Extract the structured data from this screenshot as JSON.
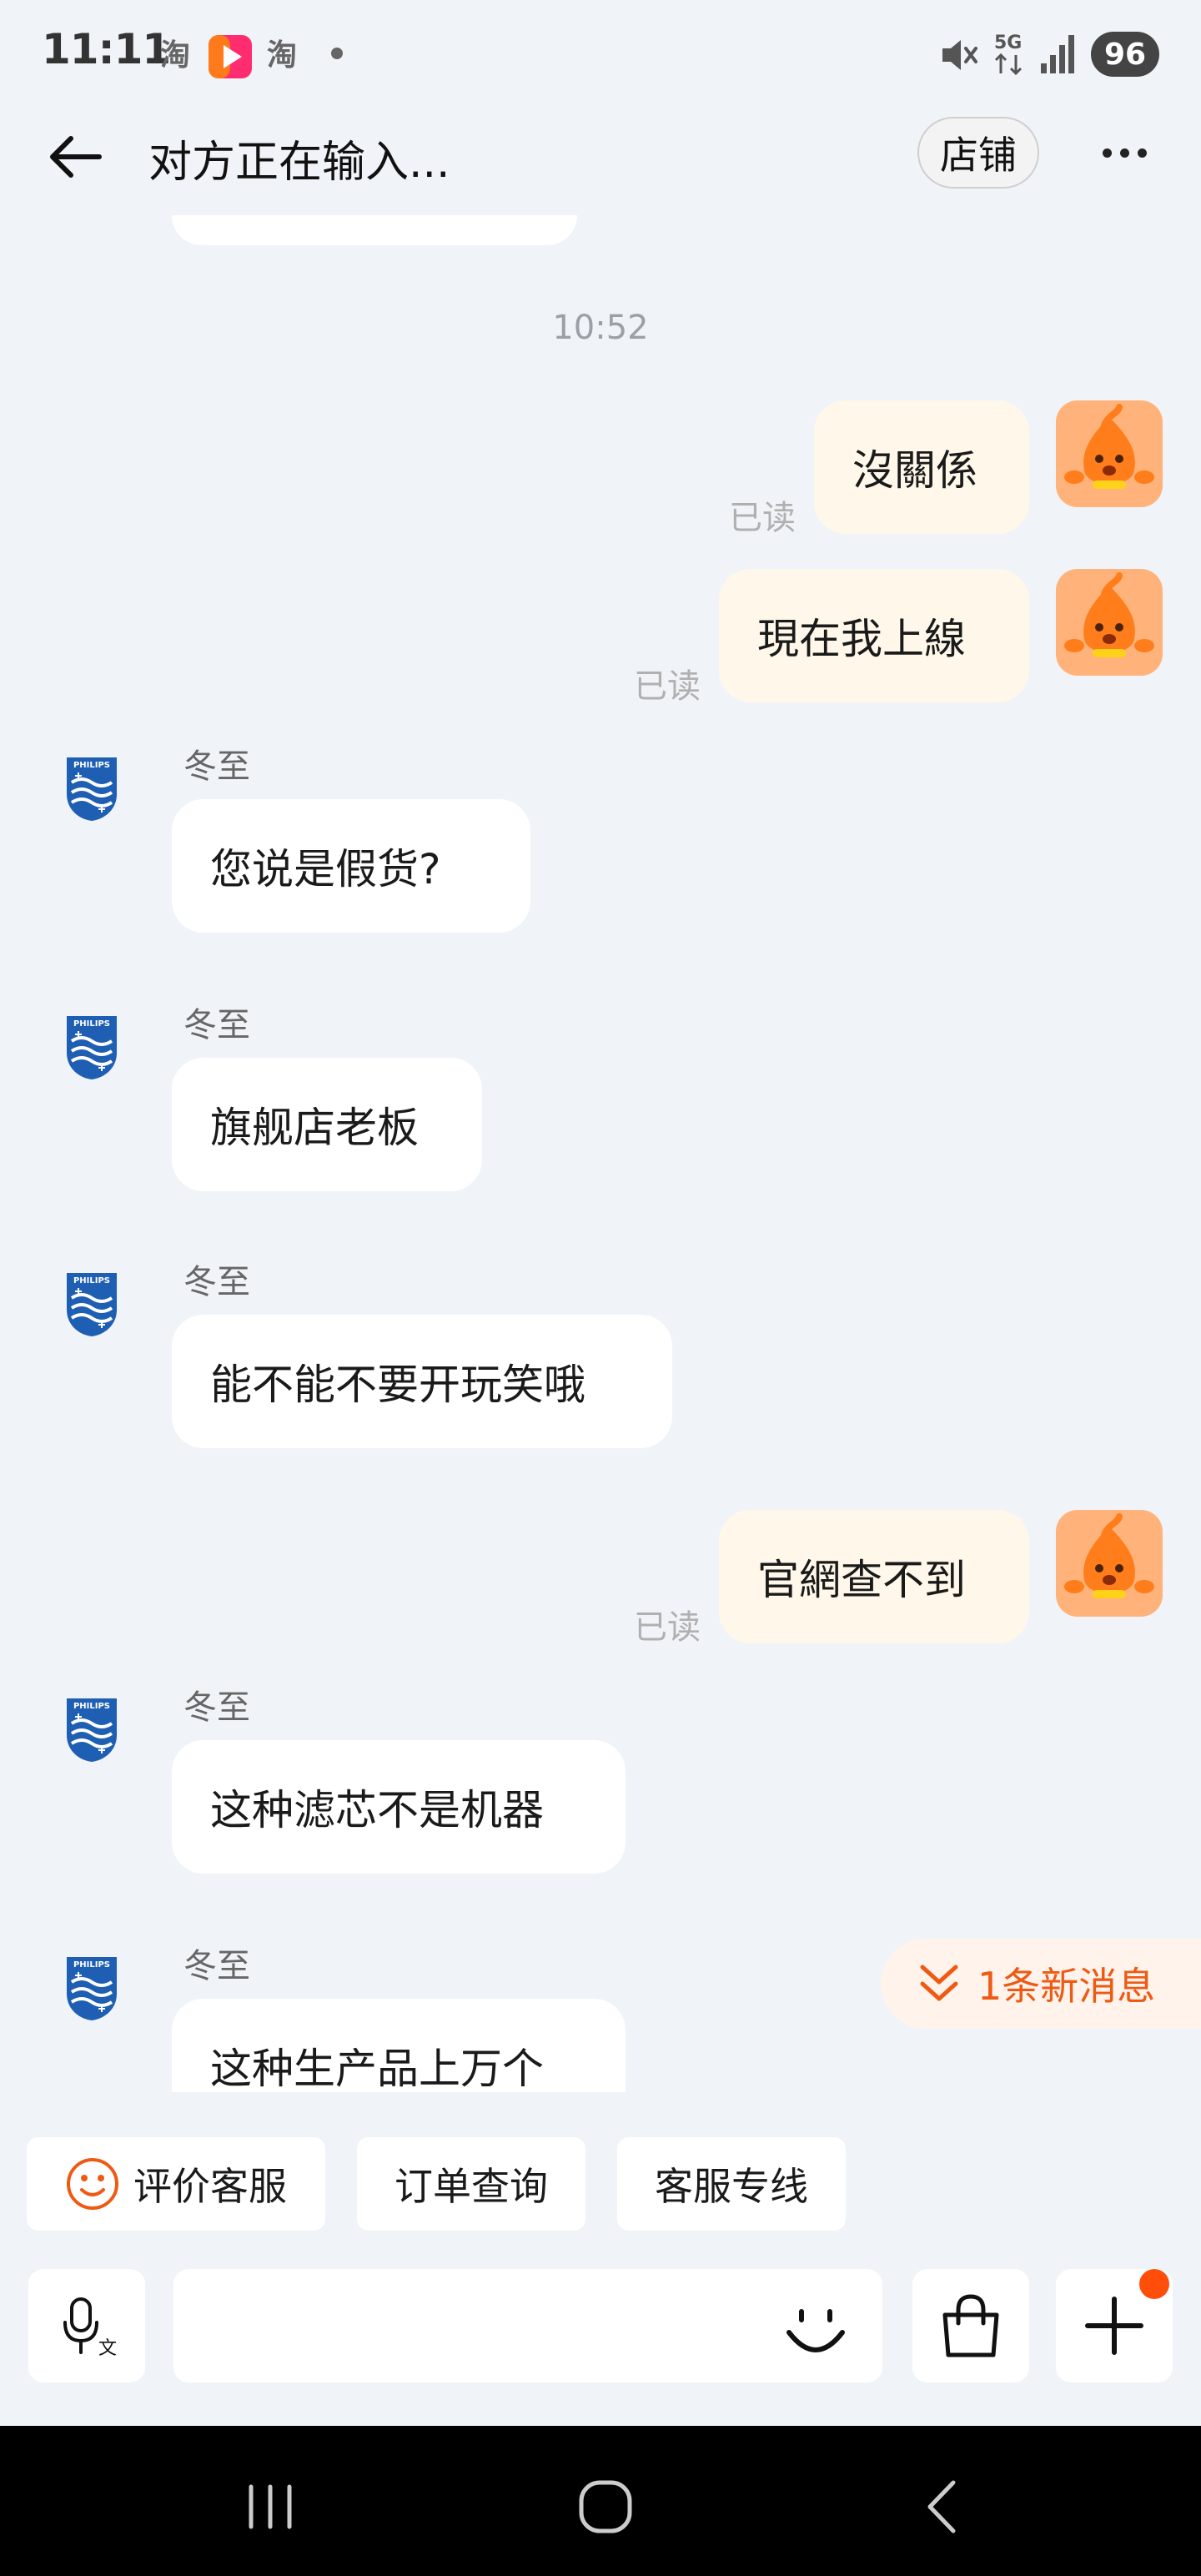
{
  "status_bar": {
    "time": "11:11",
    "app_icons": [
      "taobao-icon",
      "video-app-icon",
      "taobao-icon"
    ],
    "network": "5G",
    "battery": "96"
  },
  "header": {
    "title": "对方正在输入...",
    "store_label": "店铺"
  },
  "chat": {
    "timestamp": "10:52",
    "read_label": "已读",
    "messages": [
      {
        "from": "self",
        "text": "沒關係",
        "read": "已读"
      },
      {
        "from": "self",
        "text": "現在我上線",
        "read": "已读"
      },
      {
        "from": "shop",
        "sender": "冬至",
        "text": "您说是假货?"
      },
      {
        "from": "shop",
        "sender": "冬至",
        "text": "旗舰店老板"
      },
      {
        "from": "shop",
        "sender": "冬至",
        "text": "能不能不要开玩笑哦"
      },
      {
        "from": "self",
        "text": "官網查不到",
        "read": "已读"
      },
      {
        "from": "shop",
        "sender": "冬至",
        "text": "这种滤芯不是机器"
      },
      {
        "from": "shop",
        "sender": "冬至",
        "text": "这种生产品上万个"
      }
    ],
    "shop_avatar_text": "PHILIPS"
  },
  "new_messages": {
    "label": "1条新消息"
  },
  "quick_actions": [
    "评价客服",
    "订单查询",
    "客服专线"
  ],
  "input": {
    "placeholder": ""
  },
  "colors": {
    "background": "#f0f4f8",
    "self_bubble": "#fff8ea",
    "accent": "#ee5a13",
    "philips_blue": "#1f5fb3"
  }
}
